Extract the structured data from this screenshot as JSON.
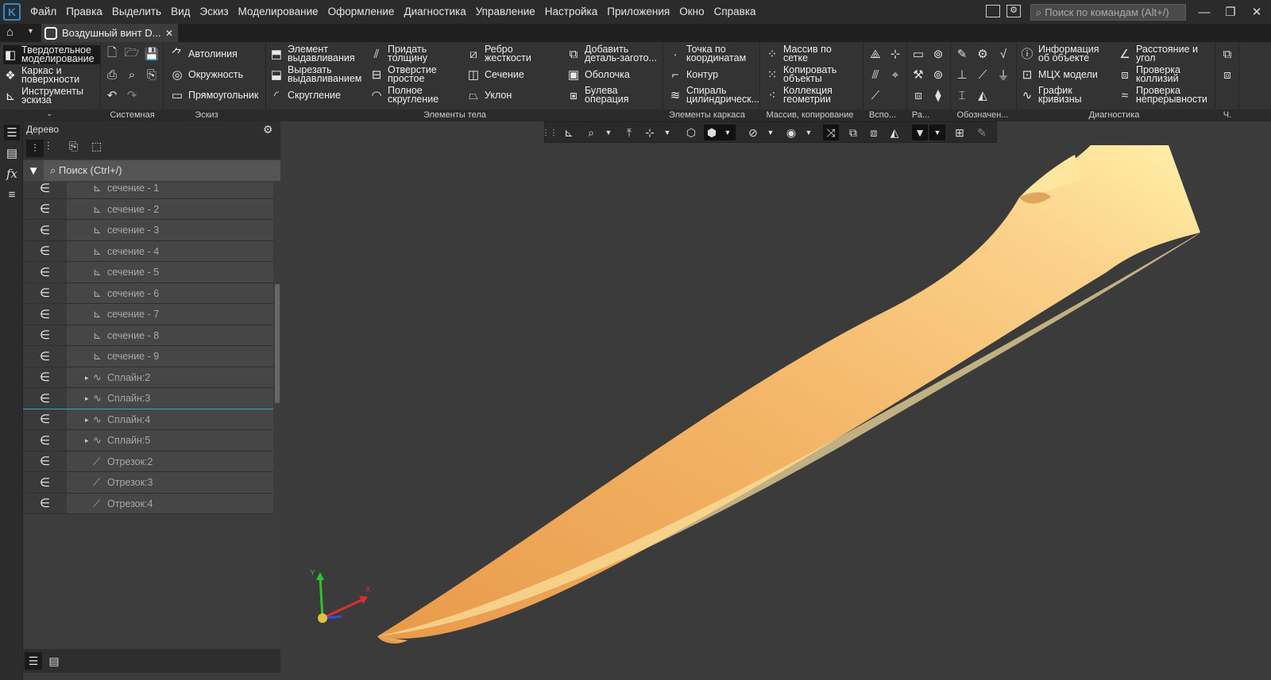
{
  "menubar": {
    "items": [
      "Файл",
      "Правка",
      "Выделить",
      "Вид",
      "Эскиз",
      "Моделирование",
      "Оформление",
      "Диагностика",
      "Управление",
      "Настройка",
      "Приложения",
      "Окно",
      "Справка"
    ],
    "search_placeholder": "Поиск по командам (Alt+/)",
    "logo_letter": "K"
  },
  "tabbar": {
    "doc_title": "Воздушный винт D...",
    "close": "✕"
  },
  "ribbon": {
    "modes": [
      {
        "label": "Твердотельное моделирование",
        "icon": "solid-icon"
      },
      {
        "label": "Каркас и поверхности",
        "icon": "surface-icon"
      },
      {
        "label": "Инструменты эскиза",
        "icon": "sketch-tools-icon"
      }
    ],
    "sketch_buttons": [
      "Автолиния",
      "Окружность",
      "Прямоугольник"
    ],
    "body_buttons": [
      "Элемент выдавливания",
      "Вырезать выдавливанием",
      "Скругление",
      "Придать толщину",
      "Отверстие простое",
      "Полное скругление",
      "Ребро жесткости",
      "Сечение",
      "Уклон",
      "Добавить деталь-загото...",
      "Оболочка",
      "Булева операция"
    ],
    "frame_buttons": [
      "Точка по координатам",
      "Контур",
      "Спираль цилиндрическ..."
    ],
    "array_buttons": [
      "Массив по сетке",
      "Копировать объекты",
      "Коллекция геометрии"
    ],
    "diag_buttons": [
      "Информация об объекте",
      "МЦХ модели",
      "График кривизны",
      "Расстояние и угол",
      "Проверка коллизий",
      "Проверка непрерывности"
    ],
    "group_labels": {
      "system": "Системная",
      "sketch": "Эскиз",
      "body": "Элементы тела",
      "frame": "Элементы каркаса",
      "array": "Массив, копирование",
      "aux": "Вспо...",
      "ra": "Ра...",
      "notation": "Обозначен...",
      "diag": "Диагностика",
      "ch": "Ч."
    }
  },
  "tree": {
    "header": "Дерево",
    "search_placeholder": "Поиск (Ctrl+/)",
    "rows": [
      {
        "label": "сечение - 1",
        "icon": "sketch-icon",
        "expandable": false
      },
      {
        "label": "сечение - 2",
        "icon": "sketch-icon",
        "expandable": false
      },
      {
        "label": "сечение - 3",
        "icon": "sketch-icon",
        "expandable": false
      },
      {
        "label": "сечение - 4",
        "icon": "sketch-icon",
        "expandable": false
      },
      {
        "label": "сечение - 5",
        "icon": "sketch-icon",
        "expandable": false
      },
      {
        "label": "сечение - 6",
        "icon": "sketch-icon",
        "expandable": false
      },
      {
        "label": "сечение - 7",
        "icon": "sketch-icon",
        "expandable": false
      },
      {
        "label": "сечение - 8",
        "icon": "sketch-icon",
        "expandable": false
      },
      {
        "label": "сечение - 9",
        "icon": "sketch-icon",
        "expandable": false
      },
      {
        "label": "Сплайн:2",
        "icon": "spline-icon",
        "expandable": true
      },
      {
        "label": "Сплайн:3",
        "icon": "spline-icon",
        "expandable": true
      },
      {
        "label": "Сплайн:4",
        "icon": "spline-icon",
        "expandable": true
      },
      {
        "label": "Сплайн:5",
        "icon": "spline-icon",
        "expandable": true
      },
      {
        "label": "Отрезок:2",
        "icon": "segment-icon",
        "expandable": false
      },
      {
        "label": "Отрезок:3",
        "icon": "segment-icon",
        "expandable": false
      },
      {
        "label": "Отрезок:4",
        "icon": "segment-icon",
        "expandable": false
      }
    ],
    "gutter_glyph": "∈"
  },
  "viewport": {
    "axes": {
      "x": "X",
      "y": "Y"
    },
    "model_color": "#f5b766",
    "background": "#3b3b3b"
  }
}
